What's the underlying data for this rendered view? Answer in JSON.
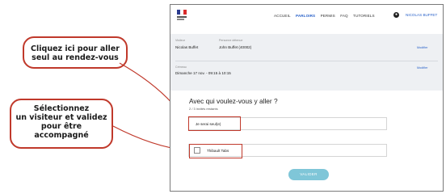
{
  "callouts": {
    "alone": [
      "Cliquez ici pour aller",
      "seul au rendez-vous"
    ],
    "visitor": [
      "Sélectionnez",
      "un visiteur et validez",
      "pour être",
      "accompagné"
    ]
  },
  "colors": {
    "callout_border": "#c0392b",
    "link_blue": "#2a62c9",
    "button": "#7fc6d8"
  },
  "header": {
    "logo_icon": "marianne-logo",
    "nav": [
      "ACCUEIL",
      "PARLOIRS",
      "PERMIS",
      "FAQ",
      "TUTORIELS"
    ],
    "active_nav": "PARLOIRS",
    "user_icon": "user-icon",
    "user_name": "NICOLAS BUFFET"
  },
  "summary": {
    "visitor_label": "Visiteur",
    "visitor_value": "Nicolas Buffet",
    "detainee_label": "Personne détenue",
    "detainee_value": "John Buffet (40002)",
    "modify_label": "Modifier",
    "slot_label": "Créneau",
    "slot_value": "Dimanche 17 nov. - 09:15 à 10:15"
  },
  "form": {
    "question": "Avec qui voulez-vous y aller ?",
    "subtitle": "2 / 3 invités restants",
    "option_alone": "Je serai seul(e)",
    "option_visitor": "Thibault Tabs",
    "validate_label": "VALIDER"
  }
}
